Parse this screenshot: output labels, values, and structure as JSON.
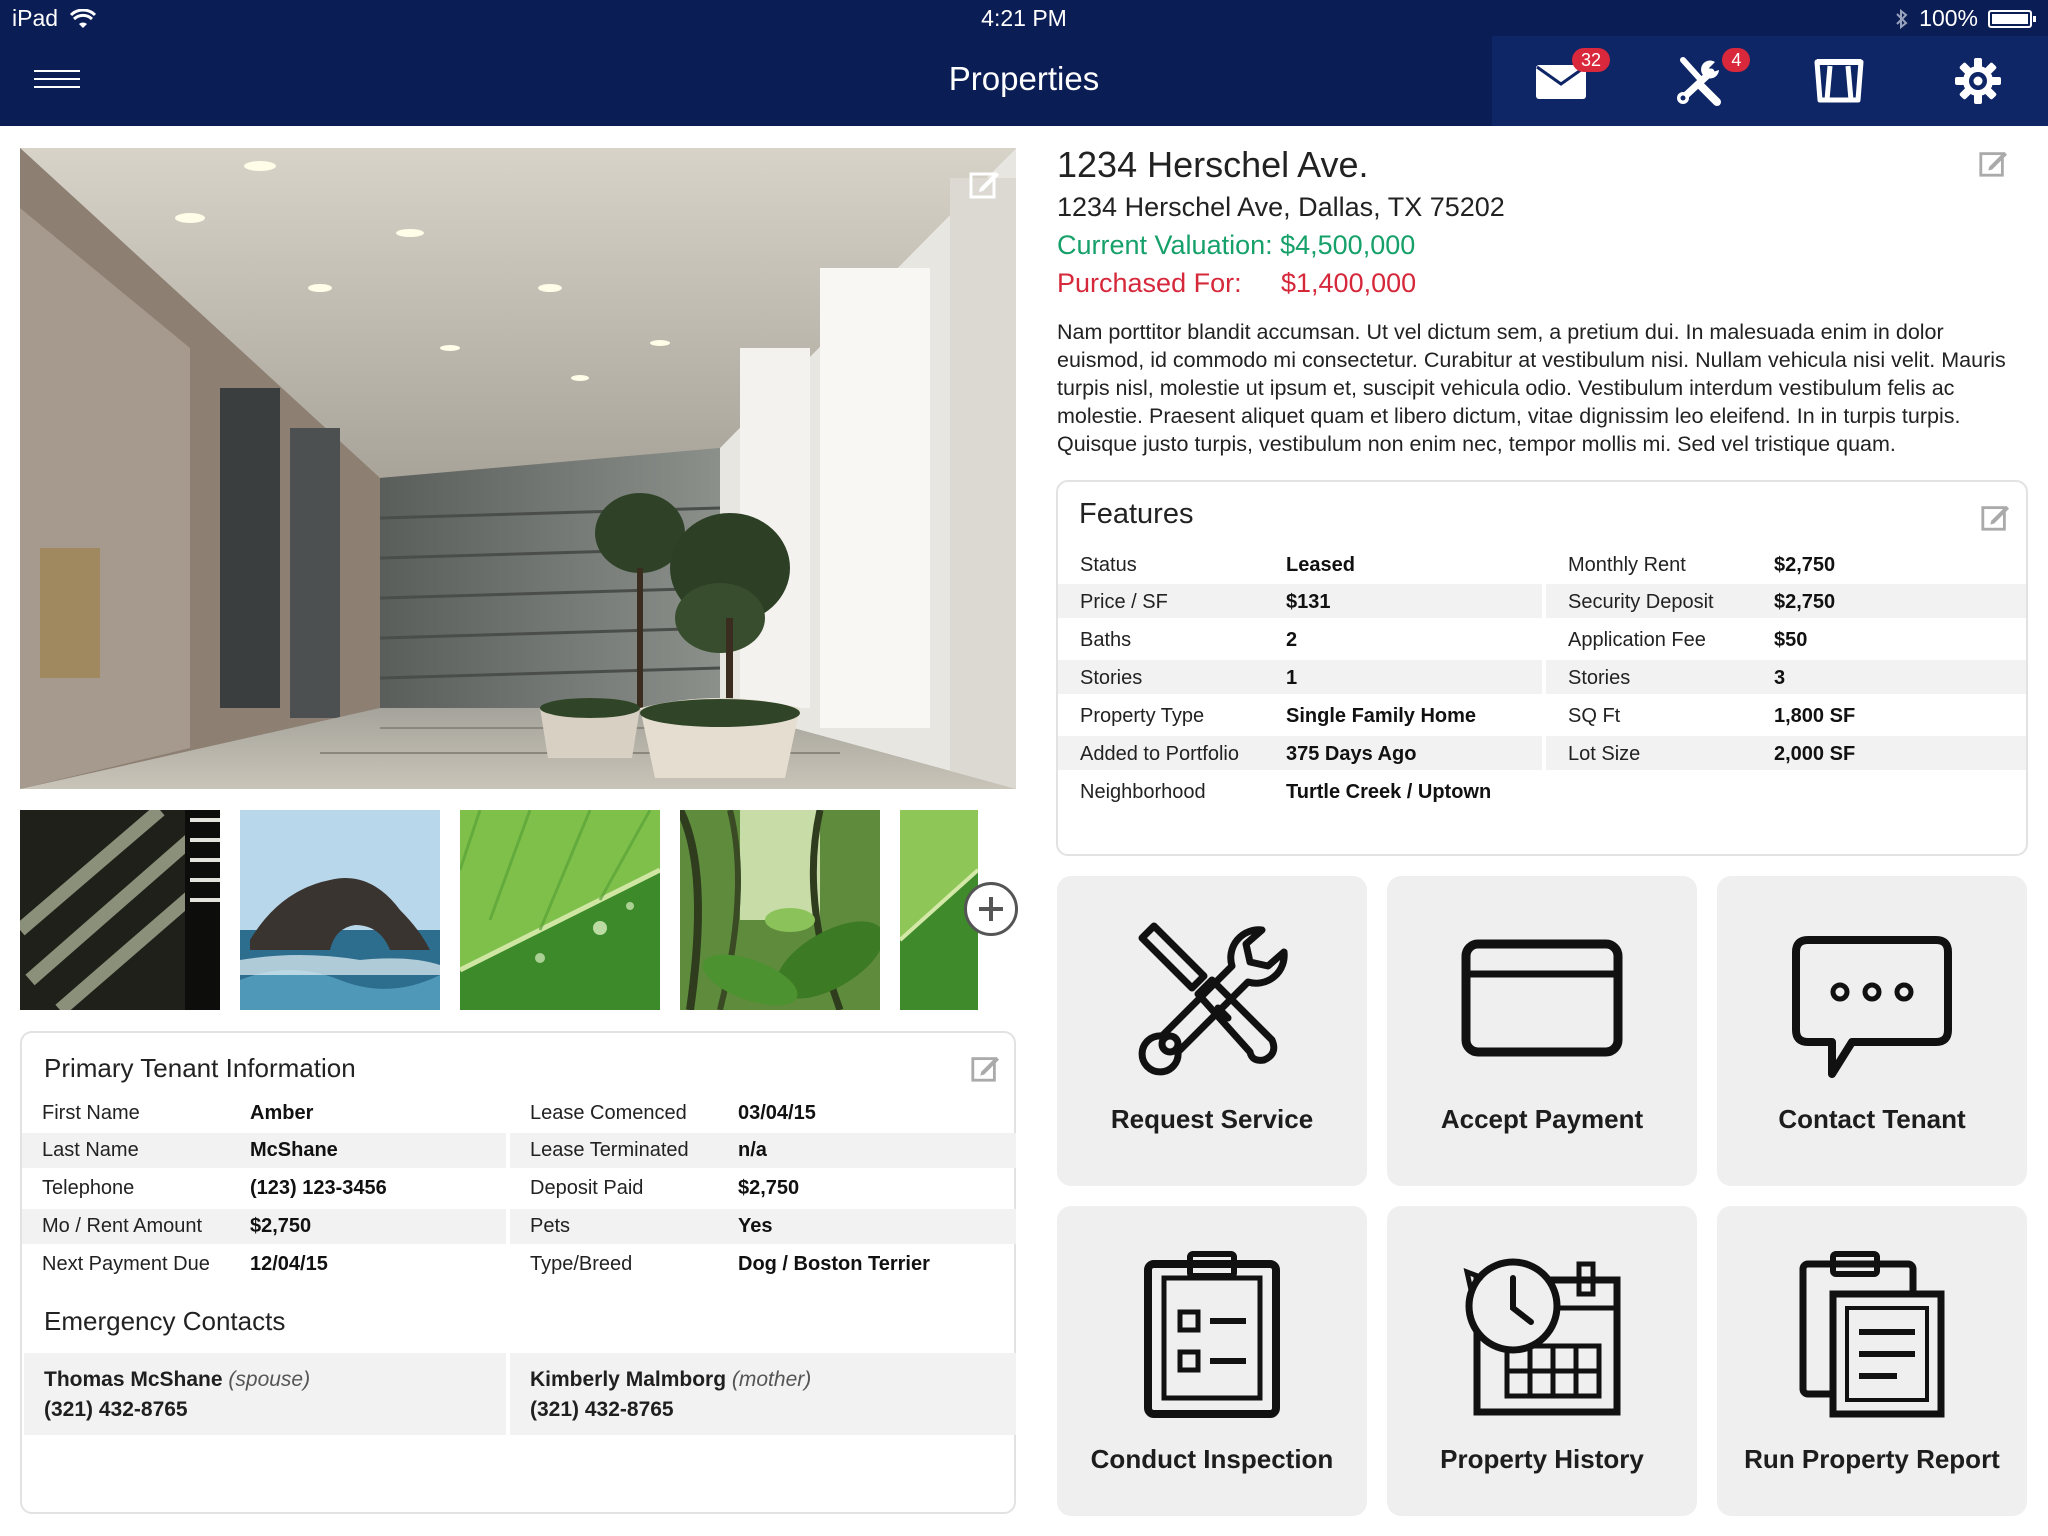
{
  "status_bar": {
    "device": "iPad",
    "time": "4:21 PM",
    "battery": "100%"
  },
  "nav": {
    "title": "Properties",
    "mail_count": "32",
    "service_count": "4"
  },
  "property": {
    "title": "1234 Herschel Ave.",
    "address": "1234 Herschel Ave, Dallas, TX 75202",
    "valuation": "Current Valuation: $4,500,000",
    "purchased_label": "Purchased For:",
    "purchased_value": "$1,400,000",
    "description": "Nam porttitor blandit accumsan. Ut vel dictum sem, a pretium dui. In malesuada enim in dolor euismod, id commodo mi consectetur. Curabitur at vestibulum nisi. Nullam vehicula nisi velit. Mauris turpis nisl, molestie ut ipsum et, suscipit vehicula odio. Vestibulum interdum vestibulum felis ac molestie. Praesent aliquet quam et libero dictum, vitae dignissim leo eleifend. In in turpis turpis. Quisque justo turpis, vestibulum non enim nec, tempor mollis mi. Sed vel tristique quam."
  },
  "features": {
    "title": "Features",
    "left": [
      {
        "label": "Status",
        "value": "Leased"
      },
      {
        "label": "Price / SF",
        "value": "$131"
      },
      {
        "label": "Baths",
        "value": "2"
      },
      {
        "label": "Stories",
        "value": "1"
      },
      {
        "label": "Property Type",
        "value": "Single Family Home"
      },
      {
        "label": "Added to Portfolio",
        "value": "375 Days Ago"
      },
      {
        "label": "Neighborhood",
        "value": "Turtle Creek / Uptown"
      }
    ],
    "right": [
      {
        "label": "Monthly Rent",
        "value": "$2,750"
      },
      {
        "label": "Security Deposit",
        "value": "$2,750"
      },
      {
        "label": "Application Fee",
        "value": "$50"
      },
      {
        "label": "Stories",
        "value": "3"
      },
      {
        "label": "SQ Ft",
        "value": "1,800 SF"
      },
      {
        "label": "Lot Size",
        "value": "2,000 SF"
      }
    ]
  },
  "tenant": {
    "title": "Primary Tenant Information",
    "left": [
      {
        "label": "First Name",
        "value": "Amber"
      },
      {
        "label": "Last Name",
        "value": "McShane"
      },
      {
        "label": "Telephone",
        "value": "(123) 123-3456"
      },
      {
        "label": "Mo / Rent Amount",
        "value": "$2,750"
      },
      {
        "label": "Next Payment Due",
        "value": "12/04/15"
      }
    ],
    "right": [
      {
        "label": "Lease Comenced",
        "value": "03/04/15"
      },
      {
        "label": "Lease Terminated",
        "value": "n/a"
      },
      {
        "label": "Deposit Paid",
        "value": "$2,750"
      },
      {
        "label": "Pets",
        "value": "Yes"
      },
      {
        "label": "Type/Breed",
        "value": "Dog / Boston Terrier"
      }
    ],
    "emergency_title": "Emergency Contacts",
    "contacts": [
      {
        "name": "Thomas McShane",
        "relation": "(spouse)",
        "phone": "(321) 432-8765"
      },
      {
        "name": "Kimberly Malmborg",
        "relation": "(mother)",
        "phone": "(321) 432-8765"
      }
    ]
  },
  "actions": [
    {
      "label": "Request Service",
      "icon": "tools-icon"
    },
    {
      "label": "Accept Payment",
      "icon": "credit-card-icon"
    },
    {
      "label": "Contact Tenant",
      "icon": "chat-bubble-icon"
    },
    {
      "label": "Conduct Inspection",
      "icon": "clipboard-checklist-icon"
    },
    {
      "label": "Property History",
      "icon": "clock-calendar-icon"
    },
    {
      "label": "Run Property Report",
      "icon": "report-clipboard-icon"
    }
  ],
  "colors": {
    "navbar": "#0b1d55",
    "valuation": "#16a06a",
    "purchased": "#d6283b",
    "badge": "#d9283b"
  }
}
